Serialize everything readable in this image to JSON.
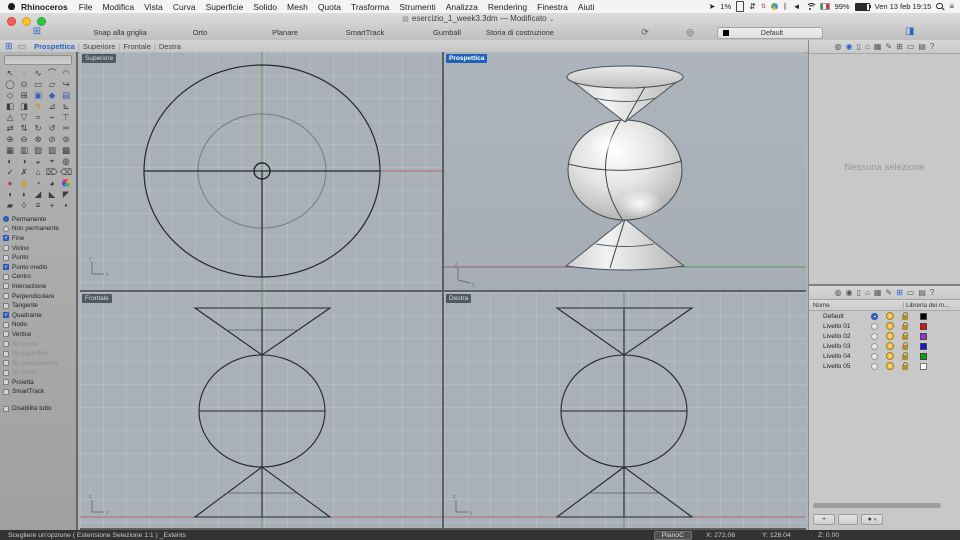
{
  "menu_bar": {
    "app_name": "Rhinoceros",
    "menus": [
      "File",
      "Modifica",
      "Vista",
      "Curva",
      "Superficie",
      "Solido",
      "Mesh",
      "Quota",
      "Trasforma",
      "Strumenti",
      "Analizza",
      "Rendering",
      "Finestra",
      "Aiuti"
    ],
    "status": {
      "location_glyph": "➤",
      "percent_small": "1%",
      "network_glyph": "⇵",
      "updown_glyph": "⇅",
      "bluetooth_glyph": "ᛒ",
      "volume_glyph": "◄",
      "battery_percent": "99%",
      "clock": "Ven 13 feb 19:15",
      "list_glyph": "≡"
    }
  },
  "window": {
    "doc_icon_glyph": "▤",
    "title": "esercizio_1_week3.3dm — Modificato",
    "title_caret": "⌄"
  },
  "toolbar": {
    "grid_icon_glyph": "⊞",
    "snap": "Snap alla griglia",
    "orto": "Orto",
    "planare": "Planare",
    "smarttrack": "SmartTrack",
    "gumball": "Gumball",
    "storia": "Storia di costruzione",
    "history_icon_glyph": "⟳",
    "target_icon_glyph": "◎",
    "layer_dropdown": "Default",
    "panel_icon_glyph": "◨"
  },
  "viewport_tabs": {
    "grid_icon_glyph": "⊞",
    "pane_icon_glyph": "▭",
    "tabs": [
      "Prospettica",
      "Superiore",
      "Frontale",
      "Destra"
    ],
    "active": 0
  },
  "viewports": {
    "top_left_label": "Superiore",
    "top_right_label": "Prospettica",
    "bottom_left_label": "Frontale",
    "bottom_right_label": "Destra",
    "axis_x": "x",
    "axis_y": "y"
  },
  "sidebar": {
    "tools": [
      {
        "g": "↖"
      },
      {
        "g": "∙"
      },
      {
        "g": "∿"
      },
      {
        "g": "⌒"
      },
      {
        "g": "◠"
      },
      {
        "g": "◯"
      },
      {
        "g": "⊙"
      },
      {
        "g": "▭"
      },
      {
        "g": "▱"
      },
      {
        "g": "↪"
      },
      {
        "g": "◇"
      },
      {
        "g": "⊞"
      },
      {
        "g": "▣",
        "c": "#3b5fb5"
      },
      {
        "g": "◆",
        "c": "#3b5fb5"
      },
      {
        "g": "▤",
        "c": "#3b5fb5"
      },
      {
        "g": "◧"
      },
      {
        "g": "◨"
      },
      {
        "g": "↯",
        "c": "#d08b1f"
      },
      {
        "g": "⊿"
      },
      {
        "g": "⊾"
      },
      {
        "g": "△"
      },
      {
        "g": "▽"
      },
      {
        "g": "≈"
      },
      {
        "g": "⌁"
      },
      {
        "g": "⊤"
      },
      {
        "g": "⇄"
      },
      {
        "g": "⇅"
      },
      {
        "g": "↻"
      },
      {
        "g": "↺"
      },
      {
        "g": "✂"
      },
      {
        "g": "⊕"
      },
      {
        "g": "⊖"
      },
      {
        "g": "⊗"
      },
      {
        "g": "⊘"
      },
      {
        "g": "⊚"
      },
      {
        "g": "▦"
      },
      {
        "g": "▥"
      },
      {
        "g": "▧"
      },
      {
        "g": "▨"
      },
      {
        "g": "▩"
      },
      {
        "g": "◐"
      },
      {
        "g": "◑"
      },
      {
        "g": "◒"
      },
      {
        "g": "◓"
      },
      {
        "g": "◍"
      },
      {
        "g": "✓"
      },
      {
        "g": "✗"
      },
      {
        "g": "⌂"
      },
      {
        "g": "⌦"
      },
      {
        "g": "⌫"
      },
      {
        "g": "●",
        "c": "#b84040"
      },
      {
        "g": "◉",
        "c": "#c9a227"
      },
      {
        "g": "◔"
      },
      {
        "g": "◕"
      },
      {
        "t": "wheel"
      },
      {
        "g": "◖"
      },
      {
        "g": "◗"
      },
      {
        "g": "◢"
      },
      {
        "g": "◣"
      },
      {
        "g": "◤"
      },
      {
        "g": "▰"
      },
      {
        "g": "◊"
      },
      {
        "g": "≡"
      },
      {
        "g": "+"
      },
      {
        "g": "▪"
      }
    ],
    "osnaps": [
      {
        "label": "Permanente",
        "type": "radio",
        "checked": true
      },
      {
        "label": "Non permanente",
        "type": "radio",
        "checked": false
      },
      {
        "label": "Fine",
        "type": "check",
        "checked": true
      },
      {
        "label": "Vicino",
        "type": "check",
        "checked": false
      },
      {
        "label": "Punto",
        "type": "check",
        "checked": false
      },
      {
        "label": "Punto medio",
        "type": "check",
        "checked": true
      },
      {
        "label": "Centro",
        "type": "check",
        "checked": false
      },
      {
        "label": "Intersezione",
        "type": "check",
        "checked": false
      },
      {
        "label": "Perpendicolare",
        "type": "check",
        "checked": false
      },
      {
        "label": "Tangente",
        "type": "check",
        "checked": false
      },
      {
        "label": "Quadrante",
        "type": "check",
        "checked": true
      },
      {
        "label": "Nodo",
        "type": "check",
        "checked": false
      },
      {
        "label": "Vertice",
        "type": "check",
        "checked": false
      },
      {
        "label": "Su curva",
        "type": "check",
        "checked": false,
        "disabled": true
      },
      {
        "label": "Su superficie",
        "type": "check",
        "checked": false,
        "disabled": true
      },
      {
        "label": "Su polisuperficie",
        "type": "check",
        "checked": false,
        "disabled": true
      },
      {
        "label": "Su mesh",
        "type": "check",
        "checked": false,
        "disabled": true
      },
      {
        "label": "Proietta",
        "type": "check",
        "checked": false
      },
      {
        "label": "SmartTrack",
        "type": "check",
        "checked": false
      },
      {
        "label": "Disabilita tutto",
        "type": "check",
        "checked": false,
        "gap": true
      }
    ]
  },
  "right_panel": {
    "panel_icons": [
      {
        "name": "eye-icon",
        "glyph": "◍"
      },
      {
        "name": "properties-ball-icon",
        "glyph": "◉",
        "color": "#2f66c8"
      },
      {
        "name": "page-icon",
        "glyph": "▯"
      },
      {
        "name": "home-icon",
        "glyph": "⌂"
      },
      {
        "name": "grid-icon",
        "glyph": "▦"
      },
      {
        "name": "pen-icon",
        "glyph": "✎"
      },
      {
        "name": "layers-icon",
        "glyph": "⊞"
      },
      {
        "name": "rect-icon",
        "glyph": "▭"
      },
      {
        "name": "display-icon",
        "glyph": "▤"
      },
      {
        "name": "help-icon",
        "glyph": "?"
      }
    ],
    "properties_placeholder": "Nessuna selezione",
    "layers": {
      "name_header": "Nome",
      "material_header": "Libreria dei m...",
      "rows": [
        {
          "name": "Default",
          "color": "#000000",
          "selected": true
        },
        {
          "name": "Livello 01",
          "color": "#dd1111",
          "selected": false
        },
        {
          "name": "Livello 02",
          "color": "#9b30d0",
          "selected": false
        },
        {
          "name": "Livello 03",
          "color": "#1515dd",
          "selected": false
        },
        {
          "name": "Livello 04",
          "color": "#0fa00f",
          "selected": false
        },
        {
          "name": "Livello 05",
          "color": "#ffffff",
          "selected": false
        }
      ],
      "add_button": "+",
      "dot_button": "●",
      "dot_caret": "▾"
    }
  },
  "status_bar": {
    "prompt": "Scegliere un'opzione ( Estensione Selezione 1:1 ) _Extents",
    "cplane": "PianoC",
    "x": "X: 272.06",
    "y": "Y: 128.04",
    "z": "Z: 0.00"
  }
}
